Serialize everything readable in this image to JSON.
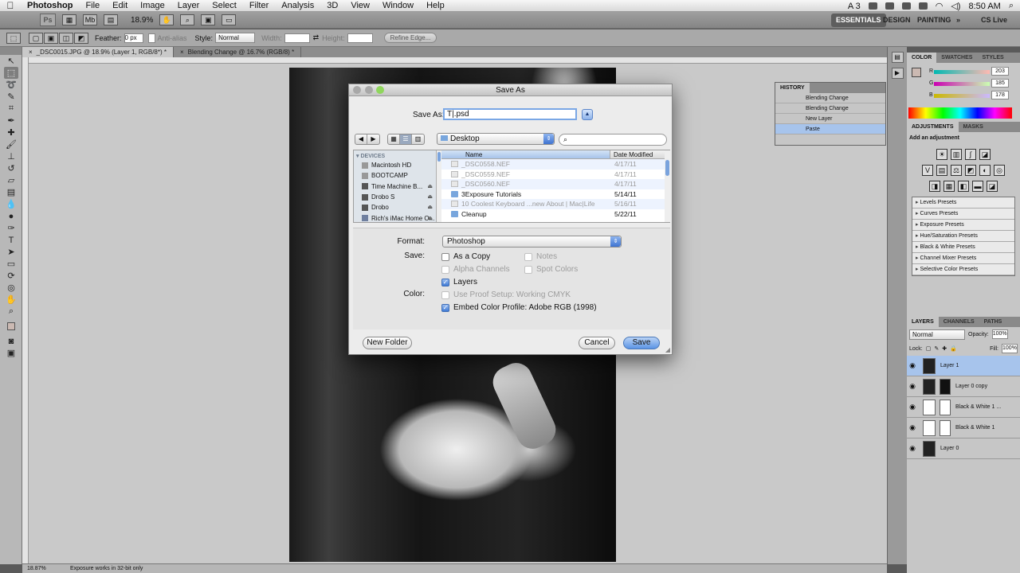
{
  "menubar": {
    "items": [
      "Photoshop",
      "File",
      "Edit",
      "Image",
      "Layer",
      "Select",
      "Filter",
      "Analysis",
      "3D",
      "View",
      "Window",
      "Help"
    ],
    "clock": "8:50 AM",
    "right_text": "A 3"
  },
  "appbar": {
    "logo": "Ps",
    "zoom": "18.9%",
    "workspaces": [
      "ESSENTIALS",
      "DESIGN",
      "PAINTING"
    ],
    "extra_label": "»",
    "cslive": "CS Live"
  },
  "options": {
    "feather_label": "Feather:",
    "feather_value": "0 px",
    "antialias_label": "Anti-alias",
    "style_label": "Style:",
    "style_value": "Normal",
    "width_label": "Width:",
    "height_label": "Height:",
    "refine_label": "Refine Edge..."
  },
  "tabs": [
    {
      "label": "_DSC0015.JPG @ 18.9% (Layer 1, RGB/8*) *",
      "active": true
    },
    {
      "label": "Blending Change @ 16.7% (RGB/8) *",
      "active": false
    }
  ],
  "statusbar": {
    "zoom": "18.87%",
    "info": "Exposure works in 32-bit only"
  },
  "history": {
    "title": "HISTORY",
    "rows": [
      "Blending Change",
      "Blending Change",
      "New Layer",
      "Paste"
    ]
  },
  "color_panel": {
    "tabs": [
      "COLOR",
      "SWATCHES",
      "STYLES"
    ],
    "r_label": "R",
    "g_label": "G",
    "b_label": "B",
    "r": "203",
    "g": "185",
    "b": "178"
  },
  "adjustments": {
    "tabs": [
      "ADJUSTMENTS",
      "MASKS"
    ],
    "title": "Add an adjustment",
    "presets": [
      "Levels Presets",
      "Curves Presets",
      "Exposure Presets",
      "Hue/Saturation Presets",
      "Black & White Presets",
      "Channel Mixer Presets",
      "Selective Color Presets"
    ]
  },
  "layers_panel": {
    "tabs": [
      "LAYERS",
      "CHANNELS",
      "PATHS"
    ],
    "blend_mode": "Normal",
    "opacity_label": "Opacity:",
    "opacity": "100%",
    "lock_label": "Lock:",
    "fill_label": "Fill:",
    "fill": "100%",
    "layers": [
      {
        "name": "Layer 1",
        "selected": true,
        "type": "photo"
      },
      {
        "name": "Layer 0 copy",
        "selected": false,
        "type": "masked"
      },
      {
        "name": "Black & White 1 ...",
        "selected": false,
        "type": "adjustment"
      },
      {
        "name": "Black & White 1",
        "selected": false,
        "type": "adjustment"
      },
      {
        "name": "Layer 0",
        "selected": false,
        "type": "photo"
      }
    ]
  },
  "dialog": {
    "title": "Save As",
    "saveas_label": "Save As:",
    "filename": "T|.psd",
    "location": "Desktop",
    "sidebar_header": "DEVICES",
    "devices": [
      {
        "name": "Macintosh HD",
        "eject": false
      },
      {
        "name": "BOOTCAMP",
        "eject": false
      },
      {
        "name": "Time Machine B...",
        "eject": true
      },
      {
        "name": "Drobo S",
        "eject": true
      },
      {
        "name": "Drobo",
        "eject": true
      },
      {
        "name": "Rich's iMac Home O...",
        "eject": true
      }
    ],
    "col_name": "Name",
    "col_date": "Date Modified",
    "files": [
      {
        "name": "_DSC0558.NEF",
        "date": "4/17/11",
        "kind": "file",
        "enabled": false
      },
      {
        "name": "_DSC0559.NEF",
        "date": "4/17/11",
        "kind": "file",
        "enabled": false
      },
      {
        "name": "_DSC0560.NEF",
        "date": "4/17/11",
        "kind": "file",
        "enabled": false
      },
      {
        "name": "3Exposure Tutorials",
        "date": "5/14/11",
        "kind": "folder",
        "enabled": true
      },
      {
        "name": "10 Coolest Keyboard ...new About | Mac|Life",
        "date": "5/16/11",
        "kind": "file",
        "enabled": false
      },
      {
        "name": "Cleanup",
        "date": "5/22/11",
        "kind": "folder",
        "enabled": true
      }
    ],
    "format_label": "Format:",
    "format_value": "Photoshop",
    "save_label": "Save:",
    "color_label": "Color:",
    "as_copy": "As a Copy",
    "notes": "Notes",
    "alpha_channels": "Alpha Channels",
    "spot_colors": "Spot Colors",
    "layers": "Layers",
    "proof_setup": "Use Proof Setup:  Working CMYK",
    "embed_profile": "Embed Color Profile:  Adobe RGB (1998)",
    "new_folder": "New Folder",
    "cancel": "Cancel",
    "save": "Save"
  }
}
